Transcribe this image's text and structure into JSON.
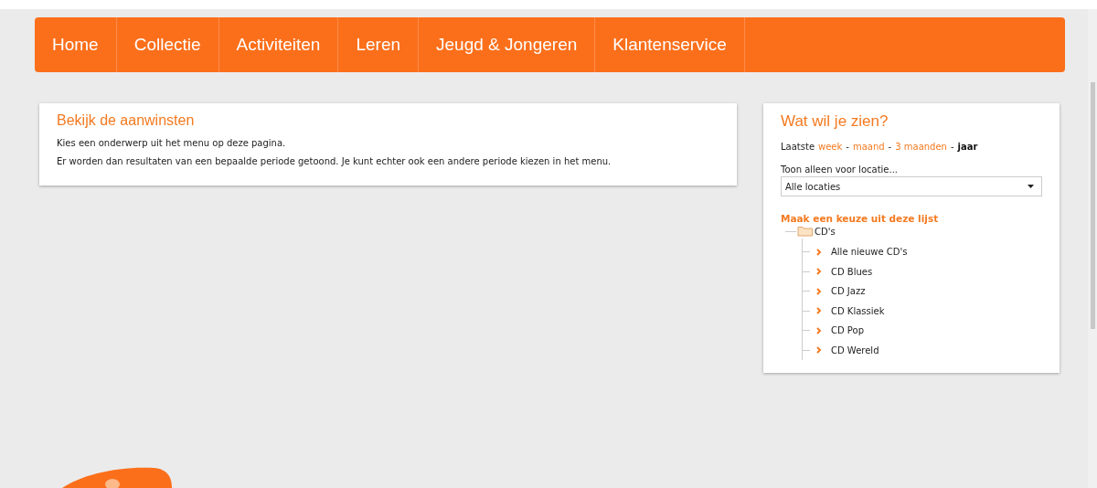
{
  "nav": [
    {
      "label": "Home"
    },
    {
      "label": "Collectie"
    },
    {
      "label": "Activiteiten"
    },
    {
      "label": "Leren"
    },
    {
      "label": "Jeugd & Jongeren"
    },
    {
      "label": "Klantenservice"
    }
  ],
  "main_card": {
    "title": "Bekijk de aanwinsten",
    "paragraphs": [
      "Kies een onderwerp uit het menu op deze pagina.",
      "Er worden dan resultaten van een bepaalde periode getoond. Je kunt echter ook een andere periode kiezen in het menu."
    ]
  },
  "side_card": {
    "title": "Wat wil je zien?",
    "period_label": "Laatste",
    "periods": [
      {
        "label": "week",
        "selected": false
      },
      {
        "label": "maand",
        "selected": false
      },
      {
        "label": "3 maanden",
        "selected": false
      },
      {
        "label": "jaar",
        "selected": true
      }
    ],
    "separator": "-",
    "location_label": "Toon alleen voor locatie...",
    "location_select": {
      "value": "Alle locaties"
    },
    "list_title": "Maak een keuze uit deze lijst",
    "tree": [
      {
        "label": "CD's",
        "children": [
          {
            "label": "Alle nieuwe CD's"
          },
          {
            "label": "CD Blues"
          },
          {
            "label": "CD Jazz"
          },
          {
            "label": "CD Klassiek"
          },
          {
            "label": "CD Pop"
          },
          {
            "label": "CD Wereld"
          }
        ]
      }
    ]
  }
}
